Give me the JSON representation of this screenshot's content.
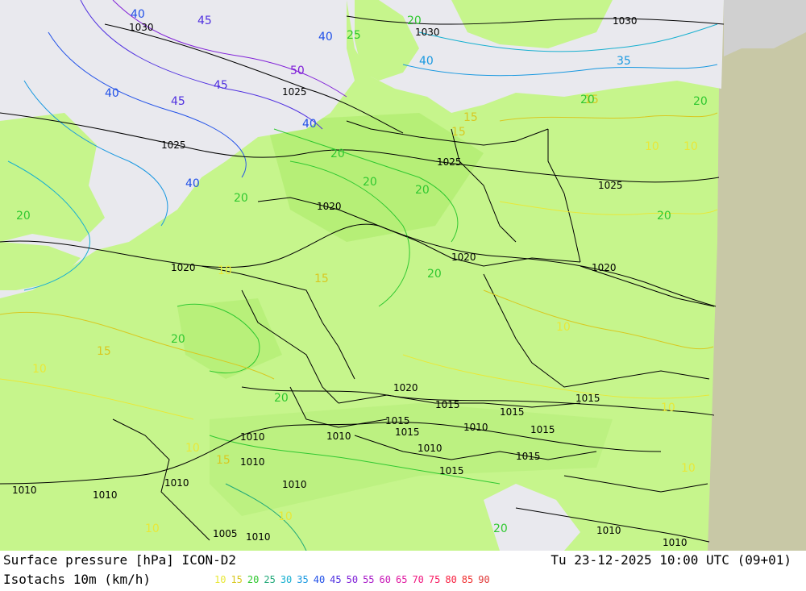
{
  "footer": {
    "product": "Surface pressure [hPa] ICON-D2",
    "valid_time": "Tu 23-12-2025 10:00 UTC (09+01)",
    "isotachs_label": "Isotachs 10m (km/h)"
  },
  "legend": [
    {
      "value": "10",
      "color": "#e8e838"
    },
    {
      "value": "15",
      "color": "#d8c820"
    },
    {
      "value": "20",
      "color": "#30c830"
    },
    {
      "value": "25",
      "color": "#20a878"
    },
    {
      "value": "30",
      "color": "#18b0d0"
    },
    {
      "value": "35",
      "color": "#1898e0"
    },
    {
      "value": "40",
      "color": "#2050e8"
    },
    {
      "value": "45",
      "color": "#5030e0"
    },
    {
      "value": "50",
      "color": "#8020d8"
    },
    {
      "value": "55",
      "color": "#a818c8"
    },
    {
      "value": "60",
      "color": "#c818b8"
    },
    {
      "value": "65",
      "color": "#e018a0"
    },
    {
      "value": "70",
      "color": "#f01880"
    },
    {
      "value": "75",
      "color": "#f81860"
    },
    {
      "value": "80",
      "color": "#f82040"
    },
    {
      "value": "85",
      "color": "#f03030"
    },
    {
      "value": "90",
      "color": "#e03838"
    }
  ],
  "colors": {
    "land_light": "#c6f58c",
    "land_mid": "#b0ee70",
    "sea": "#e9e9ee",
    "outside_domain": "#c8c8a6",
    "isobar": "#000000"
  },
  "isobar_labels": [
    "1030",
    "1030",
    "1030",
    "1025",
    "1025",
    "1025",
    "1025",
    "1020",
    "1020",
    "1020",
    "1020",
    "1020",
    "1015",
    "1015",
    "1015",
    "1015",
    "1015",
    "1015",
    "1015",
    "1015",
    "1010",
    "1010",
    "1010",
    "1010",
    "1010",
    "1010",
    "1010",
    "1010",
    "1010",
    "1010",
    "1010",
    "1005"
  ],
  "isotach_labels": [
    "40",
    "45",
    "40",
    "40",
    "50",
    "45",
    "45",
    "40",
    "40",
    "40",
    "35",
    "25",
    "20",
    "20",
    "20",
    "20",
    "20",
    "20",
    "20",
    "20",
    "15",
    "15",
    "15",
    "10",
    "10",
    "10",
    "10",
    "10",
    "10",
    "20",
    "20",
    "20",
    "20",
    "15",
    "15",
    "15",
    "10",
    "10",
    "10",
    "10",
    "20"
  ]
}
